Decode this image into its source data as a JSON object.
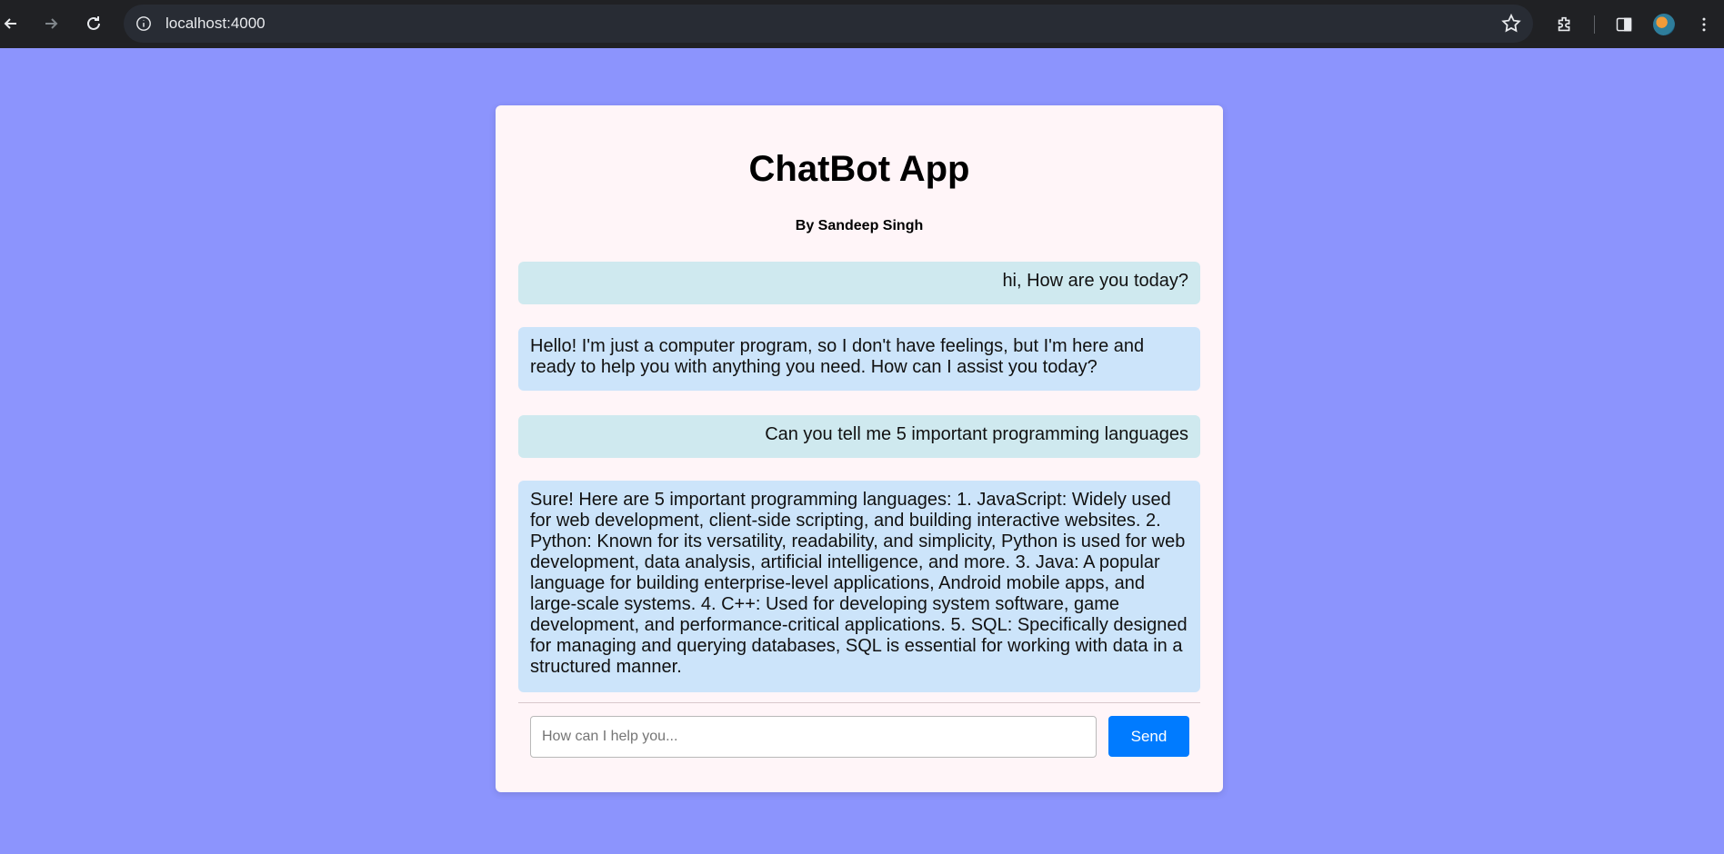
{
  "browser": {
    "url": "localhost:4000",
    "icons": [
      "back-icon",
      "forward-icon",
      "reload-icon",
      "site-info-icon",
      "bookmark-star-icon",
      "extensions-icon",
      "side-panel-icon",
      "profile-avatar",
      "more-menu-icon"
    ]
  },
  "app": {
    "title": "ChatBot App",
    "subtitle": "By Sandeep Singh"
  },
  "messages": [
    {
      "role": "user",
      "text": "hi, How are you today?"
    },
    {
      "role": "bot",
      "text": "Hello! I'm just a computer program, so I don't have feelings, but I'm here and ready to help you with anything you need. How can I assist you today?"
    },
    {
      "role": "user",
      "text": "Can you tell me 5 important programming languages"
    },
    {
      "role": "bot",
      "text": "Sure! Here are 5 important programming languages: 1. JavaScript: Widely used for web development, client-side scripting, and building interactive websites. 2. Python: Known for its versatility, readability, and simplicity, Python is used for web development, data analysis, artificial intelligence, and more. 3. Java: A popular language for building enterprise-level applications, Android mobile apps, and large-scale systems. 4. C++: Used for developing system software, game development, and performance-critical applications. 5. SQL: Specifically designed for managing and querying databases, SQL is essential for working with data in a structured manner."
    }
  ],
  "composer": {
    "placeholder": "How can I help you...",
    "value": "",
    "send_label": "Send"
  },
  "colors": {
    "page_background": "#8c94fd",
    "card_background": "#fff5f8",
    "user_bubble": "#cfe9ef",
    "bot_bubble": "#cce4fa",
    "send_button": "#007bff"
  }
}
